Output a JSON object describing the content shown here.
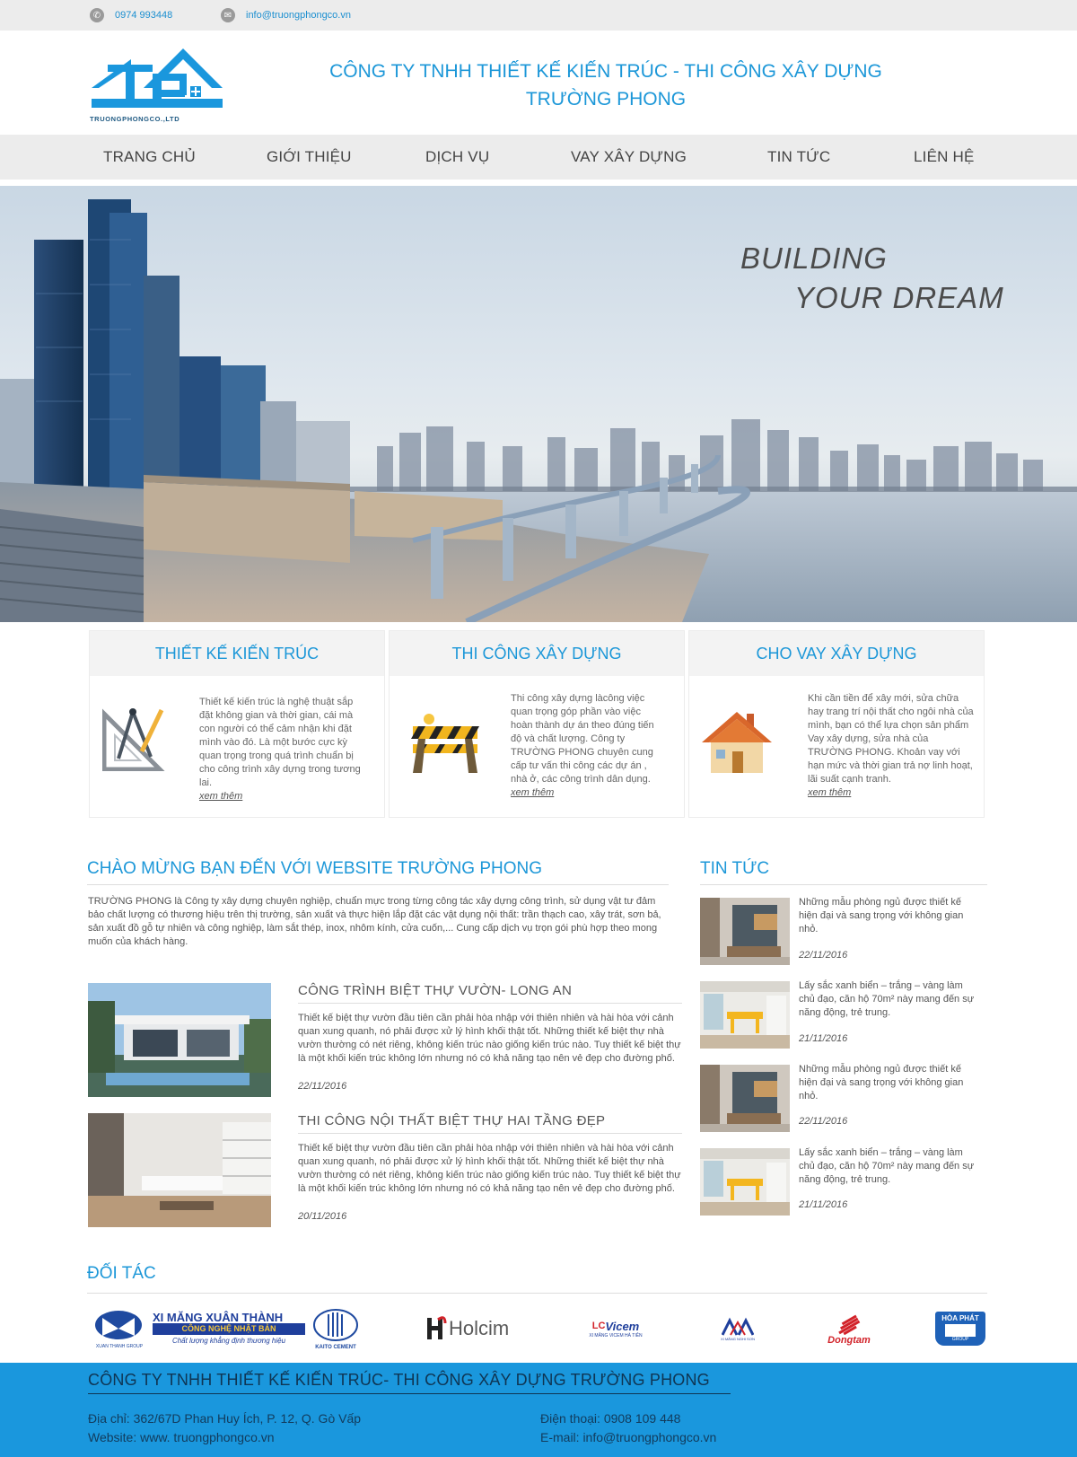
{
  "topbar": {
    "phone": "0974 993448",
    "email": "info@truongphongco.vn"
  },
  "header": {
    "logo_text": "TRUONGPHONGCO.,LTD",
    "company_line1": "CÔNG TY TNHH THIẾT KẾ KIẾN TRÚC - THI CÔNG XÂY DỰNG",
    "company_line2": "TRƯỜNG PHONG"
  },
  "nav": [
    "TRANG CHỦ",
    "GIỚI THIỆU",
    "DỊCH VỤ",
    "VAY XÂY DỰNG",
    "TIN TỨC",
    "LIÊN HỆ"
  ],
  "hero": {
    "line1": "BUILDING",
    "line2": "YOUR DREAM"
  },
  "services": [
    {
      "title": "THIẾT KẾ KIẾN TRÚC",
      "icon": "drafting-tools-icon",
      "text": "Thiết kế kiến trúc là nghệ thuật sắp đặt không gian và thời gian, cái mà con người có thể cảm nhận khi đặt mình vào đó. Là một bước cực kỳ quan trọng trong quá trình chuẩn bị cho công trình xây dựng trong tương lai.",
      "more": "xem thêm"
    },
    {
      "title": "THI CÔNG XÂY DỰNG",
      "icon": "construction-barrier-icon",
      "text": "Thi công xây dựng làcông việc quan trọng góp phần vào việc hoàn thành dự án theo đúng tiến độ và chất lượng. Công ty TRƯỜNG PHONG chuyên cung cấp tư vấn thi công các dự án , nhà ở, các công trình dân dụng.",
      "more": "xem thêm"
    },
    {
      "title": "CHO VAY XÂY DỰNG",
      "icon": "house-icon",
      "text": "Khi cần tiền để xây mới, sửa chữa hay trang trí nội thất cho ngôi nhà của mình, bạn có thể lựa chọn sản phẩm Vay xây dựng, sửa nhà của TRƯỜNG PHONG. Khoản vay với hạn mức và thời gian trả nợ linh hoạt, lãi suất cạnh tranh.",
      "more": "xem thêm"
    }
  ],
  "welcome": {
    "title": "CHÀO MỪNG BẠN ĐẾN VỚI WEBSITE TRƯỜNG PHONG",
    "text": "TRƯỜNG PHONG là Công ty xây dựng chuyên nghiệp, chuẩn mực trong từng công tác xây dựng công trình, sử dụng vật tư đảm bảo chất lượng có thương hiệu trên thị trường, sản xuất và thực hiện lắp đặt các vật dụng nội thất: trần thạch cao, xây trát, sơn bả, sản xuất đồ gỗ tự nhiên và công nghiệp, làm sắt thép, inox, nhôm kính, cửa cuốn,... Cung cấp dịch vụ trọn gói phù hợp theo mong muốn của khách hàng."
  },
  "articles": [
    {
      "title": "CÔNG TRÌNH BIỆT THỰ VƯỜN- LONG AN",
      "text": "Thiết kế biệt thự vườn đầu tiên cần phải hòa nhập với thiên nhiên và hài hòa với cảnh quan xung quanh, nó phải được xử lý hình khối thật tốt. Những thiết kế biệt thự nhà vườn thường có nét riêng, không kiến trúc nào giống kiến trúc nào. Tuy thiết kế biệt thự là một khối kiến trúc không lớn nhưng nó có khả năng tạo nên vẻ đẹp cho đường phố.",
      "date": "22/11/2016"
    },
    {
      "title": "THI CÔNG NỘI THẤT BIỆT THỰ HAI TẦNG ĐẸP",
      "text": "Thiết kế biệt thự vườn đầu tiên cần phải hòa nhập với thiên nhiên và hài hòa với cảnh quan xung quanh, nó phải được xử lý hình khối thật tốt. Những thiết kế biệt thự nhà vườn thường có nét riêng, không kiến trúc nào giống kiến trúc nào. Tuy thiết kế biệt thự là một khối kiến trúc không lớn nhưng nó có khả năng tạo nên vẻ đẹp cho đường phố.",
      "date": "20/11/2016"
    }
  ],
  "news": {
    "title": "TIN TỨC",
    "items": [
      {
        "text": "Những mẫu phòng ngủ được thiết kế hiện đại và sang trọng với không gian nhỏ.",
        "date": "22/11/2016"
      },
      {
        "text": "Lấy sắc xanh biển – trắng – vàng làm chủ đạo, căn hộ 70m² này mang đến sự năng động, trẻ trung.",
        "date": "21/11/2016"
      },
      {
        "text": "Những mẫu phòng ngủ được thiết kế hiện đại và sang trọng với không gian nhỏ.",
        "date": "22/11/2016"
      },
      {
        "text": "Lấy sắc xanh biển – trắng – vàng làm chủ đạo, căn hộ 70m² này mang đến sự năng động, trẻ trung.",
        "date": "21/11/2016"
      }
    ]
  },
  "partners": {
    "title": "ĐỐI TÁC",
    "xuanthanh": {
      "name": "XI MĂNG XUÂN THÀNH",
      "sub": "CÔNG NGHỆ NHẬT BẢN",
      "slogan": "Chất lượng khẳng định thương hiệu",
      "group": "XUAN THANH GROUP",
      "kaito": "KAITO CEMENT"
    },
    "holcim": "Holcim",
    "vicem": {
      "name": "Vicem",
      "sub": "XI MĂNG VICEM HÀ TIÊN"
    },
    "nghison": "XI MĂNG NGHI SƠN",
    "dongtam": "Dongtam",
    "hoaphat": {
      "name": "HÒA PHÁT",
      "sub": "GROUP"
    }
  },
  "footer": {
    "company": "CÔNG TY TNHH THIẾT KẾ KIẾN TRÚC- THI CÔNG XÂY DỰNG TRƯỜNG PHONG",
    "address": "Địa chỉ: 362/67D Phan Huy Ích, P. 12, Q. Gò Vấp",
    "website": "Website: www. truongphongco.vn",
    "phone": "Điện thoại: 0908 109 448",
    "email": "E-mail: info@truongphongco.vn"
  },
  "colors": {
    "accent": "#1c97d8",
    "footer_bg": "#1a97dd",
    "bar_bg": "#ececec"
  }
}
